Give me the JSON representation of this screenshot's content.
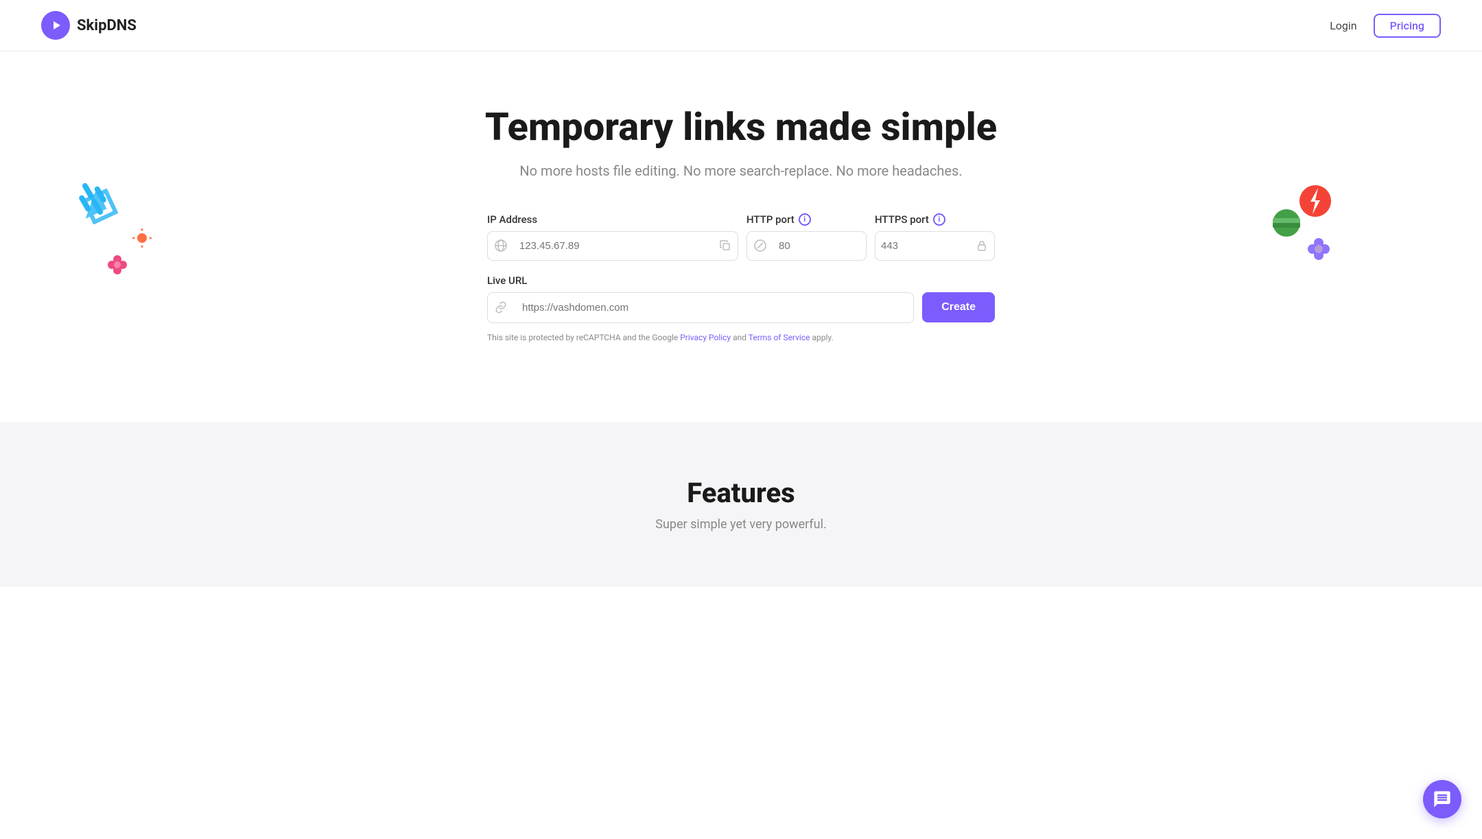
{
  "header": {
    "logo_text": "SkipDNS",
    "nav": {
      "login_label": "Login",
      "pricing_label": "Pricing"
    }
  },
  "hero": {
    "title": "Temporary links made simple",
    "subtitle": "No more hosts file editing. No more search-replace. No more headaches.",
    "form": {
      "ip_label": "IP Address",
      "ip_placeholder": "123.45.67.89",
      "http_label": "HTTP port",
      "http_placeholder": "80",
      "https_label": "HTTPS port",
      "https_placeholder": "443",
      "live_url_label": "Live URL",
      "live_url_placeholder": "https://vashdomen.com",
      "create_label": "Create",
      "captcha_text": "This site is protected by reCAPTCHA and the Google ",
      "privacy_label": "Privacy Policy",
      "and_text": " and ",
      "terms_label": "Terms of Service",
      "apply_text": " apply."
    }
  },
  "features": {
    "title": "Features",
    "subtitle": "Super simple yet very powerful."
  },
  "icons": {
    "logo": "▶",
    "globe": "🌐",
    "copy": "⧉",
    "slash": "⊘",
    "lock": "🔒",
    "link": "🔗",
    "info": "i",
    "chat": "💬"
  }
}
